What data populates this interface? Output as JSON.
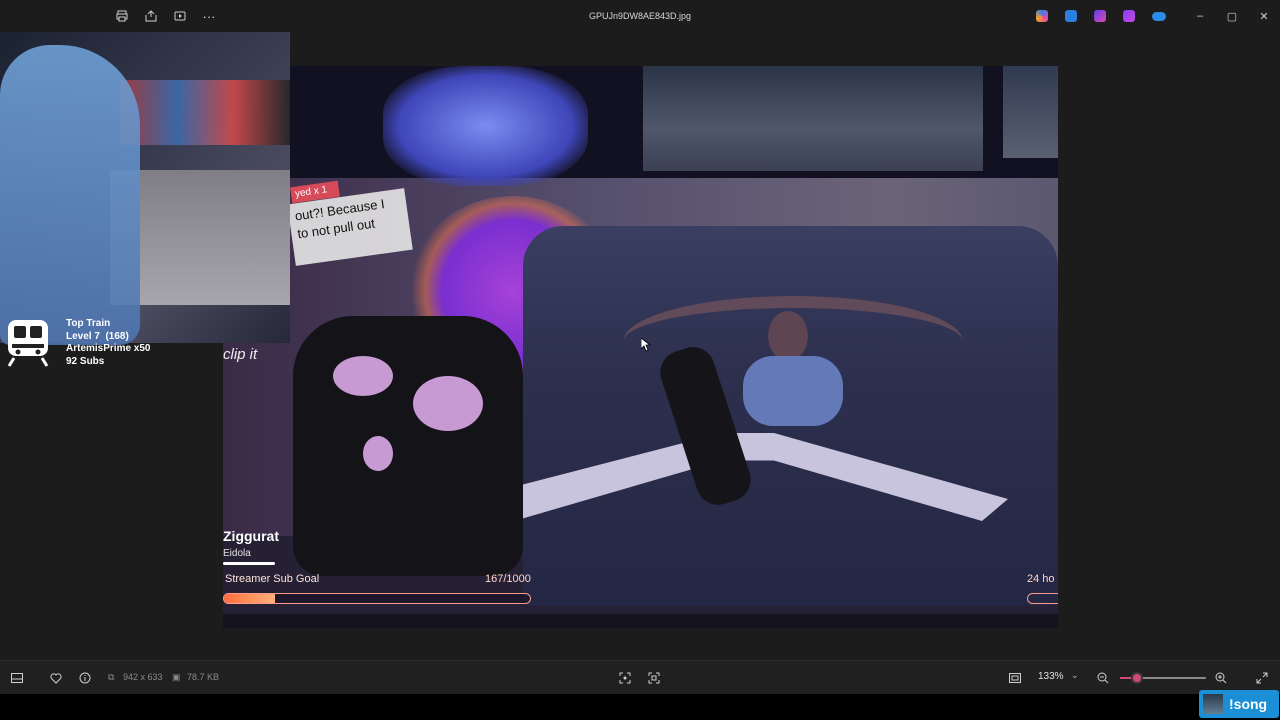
{
  "titlebar": {
    "filename": "GPUJn9DW8AE843D.jpg",
    "left_icons": [
      "print-icon",
      "share-icon",
      "slideshow-icon",
      "more-icon"
    ],
    "more_glyph": "···",
    "app_icons": [
      "copilot-icon",
      "edit-icon",
      "clipchamp-icon",
      "designer-icon",
      "onedrive-icon"
    ],
    "window_buttons": {
      "minimize": "–",
      "maximize": "▢",
      "close": "✕"
    }
  },
  "stream_overlay": {
    "top_train": {
      "title": "Top Train",
      "level": "Level 7  (168)",
      "top_user": "ArtemisPrime x50",
      "subs": "92 Subs"
    },
    "chat_fragment": {
      "tag": "yed x 1",
      "line1": "out?! Because I",
      "line2": "to not pull out"
    },
    "clip_text": "clip it",
    "now_playing": {
      "title": "Ziggurat",
      "artist": "Eidola"
    },
    "sub_goal": {
      "label": "Streamer Sub Goal",
      "count": "167/1000",
      "progress": 0.167
    },
    "right_label": "24 ho"
  },
  "toolbar": {
    "dimensions": "942 x 633",
    "file_size": "78.7 KB",
    "zoom_label": "133%",
    "zoom_fraction": 0.2
  },
  "song_badge": "!song",
  "colors": {
    "accent": "#d04a72",
    "goal_border": "#ff9a8a",
    "badge": "#1b8fd6"
  }
}
